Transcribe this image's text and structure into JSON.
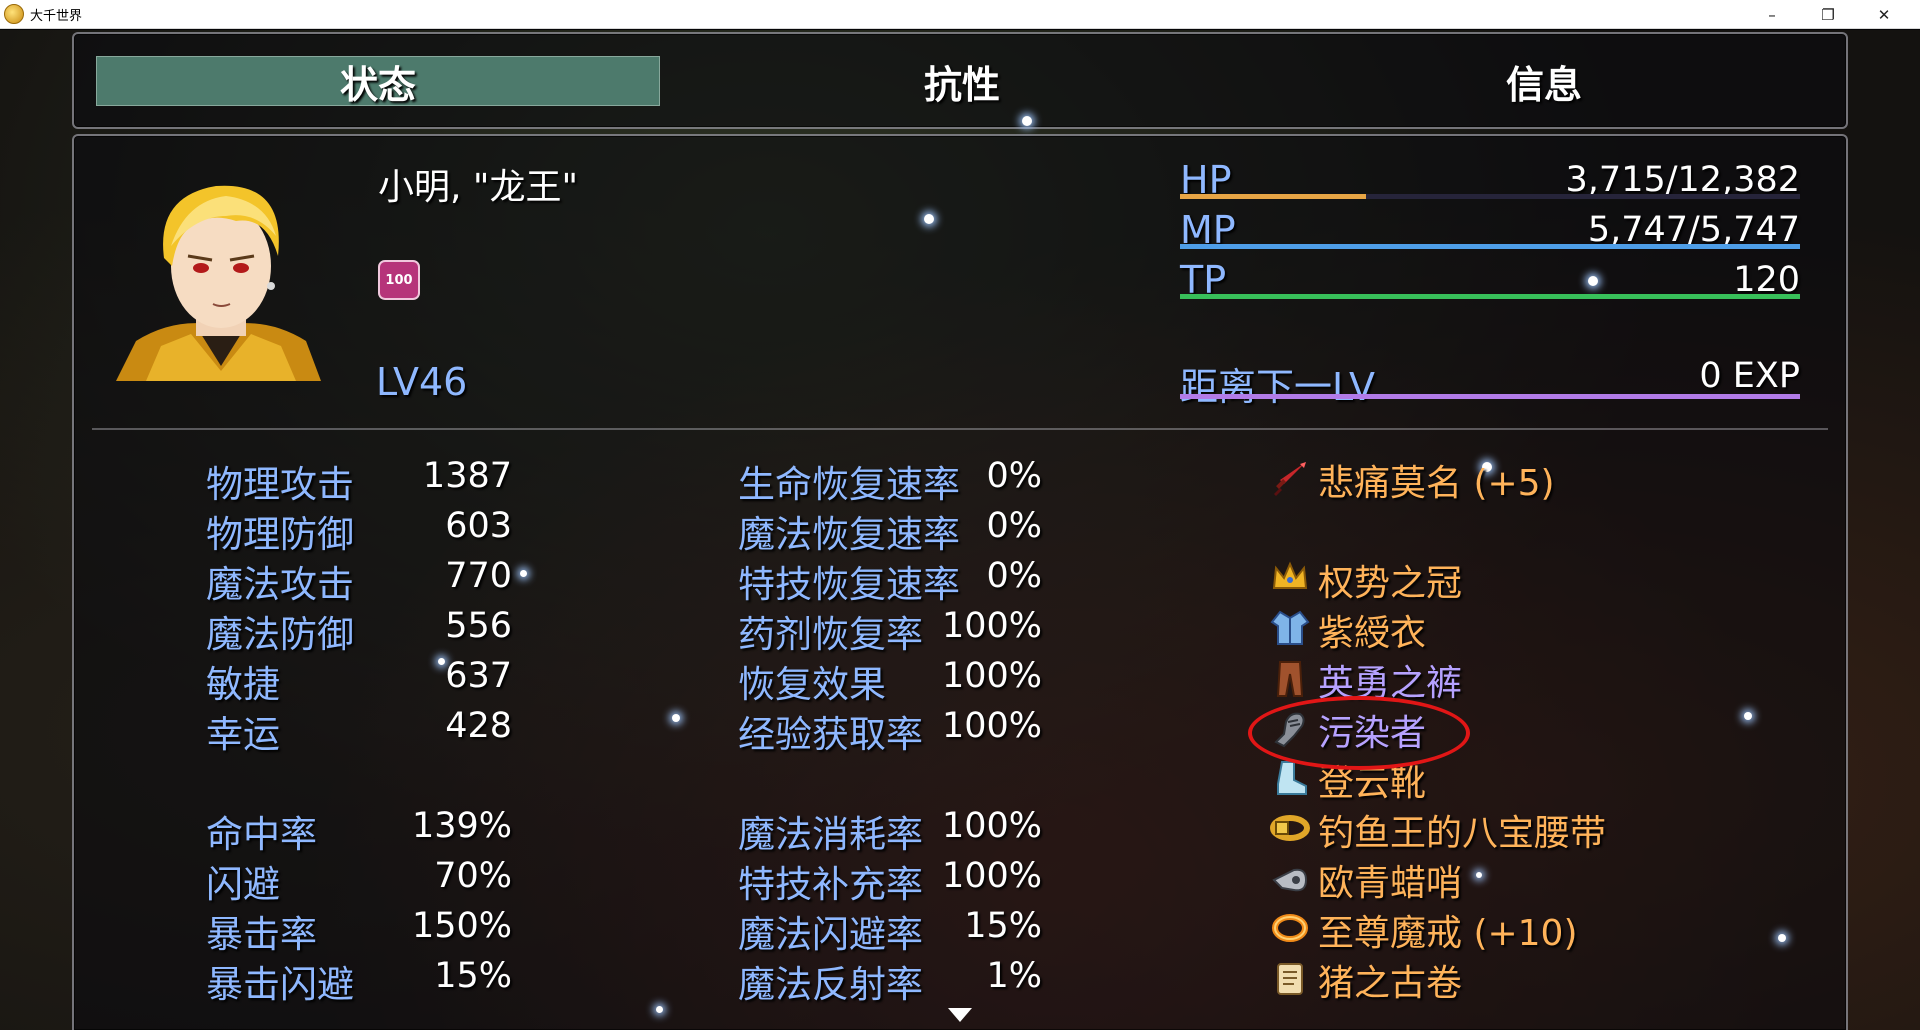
{
  "window": {
    "title": "大千世界",
    "minimize": "–",
    "restore": "❐",
    "close": "✕"
  },
  "tabs": [
    {
      "label": "状态",
      "active": true
    },
    {
      "label": "抗性",
      "active": false
    },
    {
      "label": "信息",
      "active": false
    }
  ],
  "actor": {
    "name": "小明, \"龙王\"",
    "state_icon_text": "100",
    "level": "LV46"
  },
  "gauges": {
    "hp": {
      "label": "HP",
      "value": "3,715/12,382",
      "fill": 0.3,
      "color": "#e7a545"
    },
    "mp": {
      "label": "MP",
      "value": "5,747/5,747",
      "fill": 1.0,
      "color": "#4e9ee8"
    },
    "tp": {
      "label": "TP",
      "value": "120",
      "fill": 1.0,
      "color": "#38c05a"
    },
    "exp": {
      "label": "距离下一LV",
      "value": "0 EXP",
      "fill": 1.0,
      "color": "#b27be8"
    }
  },
  "params": [
    {
      "label": "物理攻击",
      "value": "1387"
    },
    {
      "label": "物理防御",
      "value": "603"
    },
    {
      "label": "魔法攻击",
      "value": "770"
    },
    {
      "label": "魔法防御",
      "value": "556"
    },
    {
      "label": "敏捷",
      "value": "637"
    },
    {
      "label": "幸运",
      "value": "428"
    }
  ],
  "xparams": [
    {
      "label": "命中率",
      "value": "139%"
    },
    {
      "label": "闪避",
      "value": "70%"
    },
    {
      "label": "暴击率",
      "value": "150%"
    },
    {
      "label": "暴击闪避",
      "value": "15%"
    }
  ],
  "sparams_top": [
    {
      "label": "生命恢复速率",
      "value": "0%"
    },
    {
      "label": "魔法恢复速率",
      "value": "0%"
    },
    {
      "label": "特技恢复速率",
      "value": "0%"
    },
    {
      "label": "药剂恢复率",
      "value": "100%"
    },
    {
      "label": "恢复效果",
      "value": "100%"
    },
    {
      "label": "经验获取率",
      "value": "100%"
    }
  ],
  "sparams_bottom": [
    {
      "label": "魔法消耗率",
      "value": "100%"
    },
    {
      "label": "特技补充率",
      "value": "100%"
    },
    {
      "label": "魔法闪避率",
      "value": "15%"
    },
    {
      "label": "魔法反射率",
      "value": "1%"
    }
  ],
  "equipment": [
    {
      "name": "悲痛莫名 (+5)",
      "icon": "sword-icon",
      "color": "#ffb35a"
    },
    {
      "name": "",
      "icon": "",
      "color": "#ffb35a"
    },
    {
      "name": "权势之冠",
      "icon": "crown-icon",
      "color": "#ffb35a"
    },
    {
      "name": "紫綬衣",
      "icon": "robe-icon",
      "color": "#ffb35a"
    },
    {
      "name": "英勇之裤",
      "icon": "pants-icon",
      "color": "#b6a2ff"
    },
    {
      "name": "污染者",
      "icon": "gauntlet-icon",
      "color": "#b6a2ff"
    },
    {
      "name": "登云靴",
      "icon": "boots-icon",
      "color": "#ffb35a"
    },
    {
      "name": "钓鱼王的八宝腰带",
      "icon": "belt-icon",
      "color": "#ffb35a"
    },
    {
      "name": "欧青蜡哨",
      "icon": "whistle-icon",
      "color": "#ffb35a"
    },
    {
      "name": "至尊魔戒 (+10)",
      "icon": "ring-icon",
      "color": "#ffb35a"
    },
    {
      "name": "猪之古卷",
      "icon": "scroll-icon",
      "color": "#ffb35a"
    }
  ]
}
